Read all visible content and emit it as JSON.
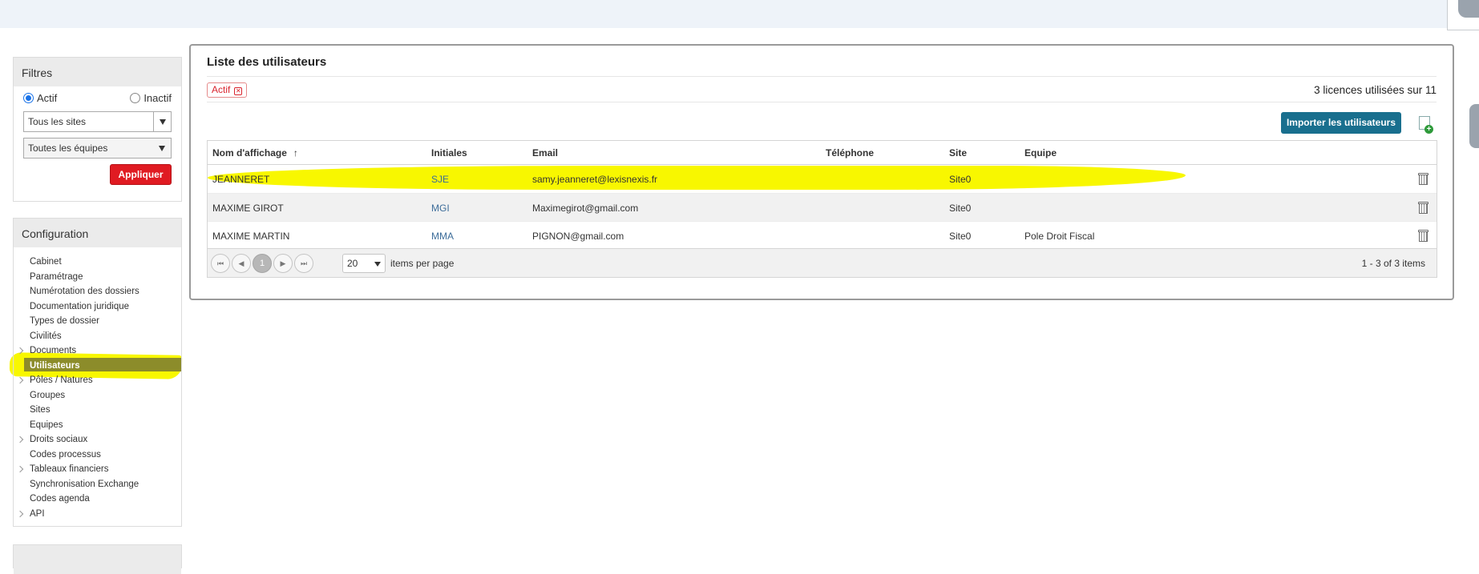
{
  "filters": {
    "title": "Filtres",
    "status_active": "Actif",
    "status_inactive": "Inactif",
    "site_select": "Tous les sites",
    "team_select": "Toutes les équipes",
    "apply_label": "Appliquer"
  },
  "config": {
    "title": "Configuration",
    "items": [
      {
        "label": "Cabinet",
        "expandable": false
      },
      {
        "label": "Paramétrage",
        "expandable": false
      },
      {
        "label": "Numérotation des dossiers",
        "expandable": false
      },
      {
        "label": "Documentation juridique",
        "expandable": false
      },
      {
        "label": "Types de dossier",
        "expandable": false
      },
      {
        "label": "Civilités",
        "expandable": false
      },
      {
        "label": "Documents",
        "expandable": true
      },
      {
        "label": "Utilisateurs",
        "expandable": false,
        "active": true
      },
      {
        "label": "Pôles / Natures",
        "expandable": true
      },
      {
        "label": "Groupes",
        "expandable": false
      },
      {
        "label": "Sites",
        "expandable": false
      },
      {
        "label": "Equipes",
        "expandable": false
      },
      {
        "label": "Droits sociaux",
        "expandable": true
      },
      {
        "label": "Codes processus",
        "expandable": false
      },
      {
        "label": "Tableaux financiers",
        "expandable": true
      },
      {
        "label": "Synchronisation Exchange",
        "expandable": false
      },
      {
        "label": "Codes agenda",
        "expandable": false
      },
      {
        "label": "API",
        "expandable": true
      }
    ]
  },
  "main": {
    "title": "Liste des utilisateurs",
    "active_filter_tag": "Actif",
    "licences": "3 licences utilisées sur 11",
    "import_label": "Importer les utilisateurs",
    "columns": {
      "name": "Nom d'affichage",
      "initials": "Initiales",
      "email": "Email",
      "phone": "Téléphone",
      "site": "Site",
      "team": "Equipe"
    },
    "sort_indicator": "↑",
    "rows": [
      {
        "name": "JEANNERET",
        "initials": "SJE",
        "email": "samy.jeanneret@lexisnexis.fr",
        "phone": "",
        "site": "Site0",
        "team": ""
      },
      {
        "name": "MAXIME GIROT",
        "initials": "MGI",
        "email": "Maximegirot@gmail.com",
        "phone": "",
        "site": "Site0",
        "team": ""
      },
      {
        "name": "MAXIME MARTIN",
        "initials": "MMA",
        "email": "PIGNON@gmail.com",
        "phone": "",
        "site": "Site0",
        "team": "Pole Droit Fiscal"
      }
    ],
    "pager": {
      "current_page": "1",
      "page_size": "20",
      "items_per_page_label": "items per page",
      "count_label": "1 - 3 of 3 items"
    }
  }
}
